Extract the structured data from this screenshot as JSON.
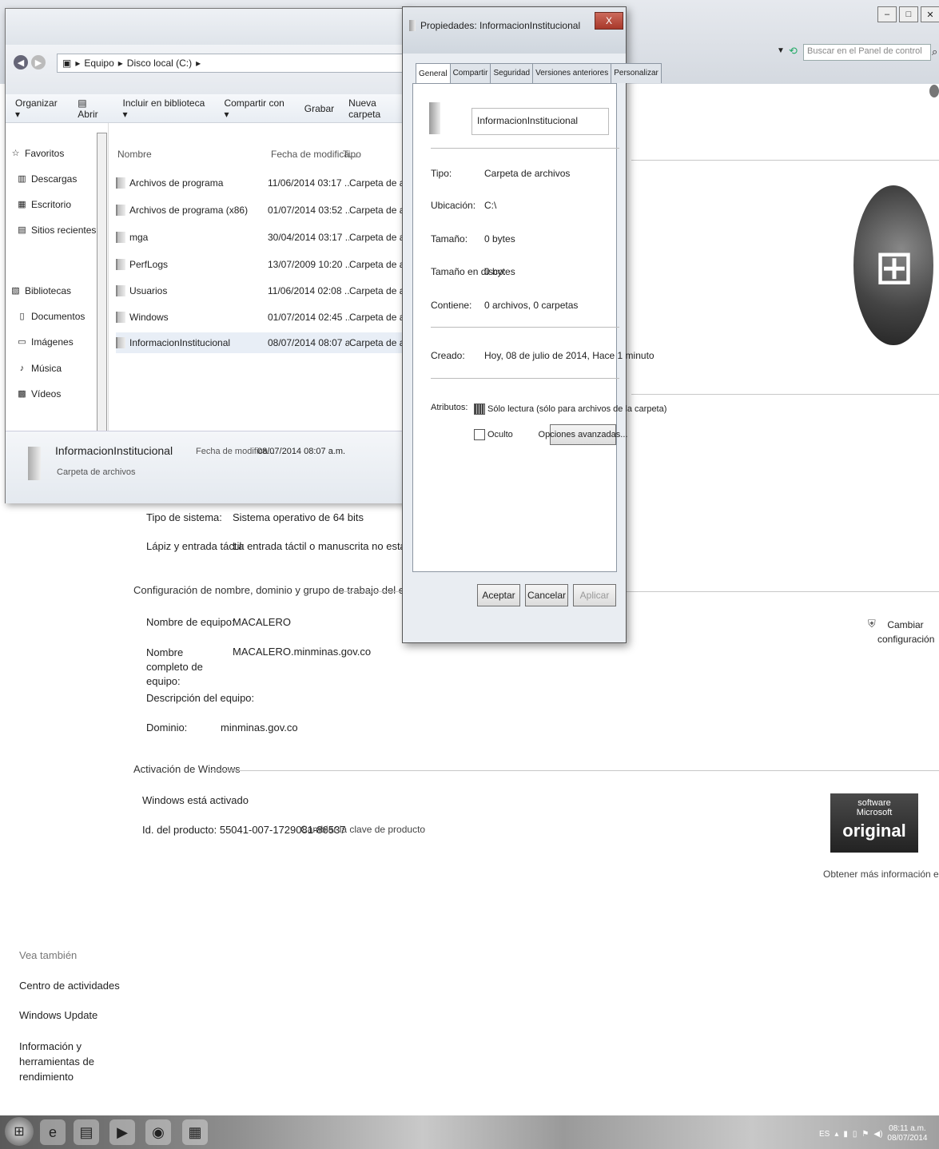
{
  "control_panel": {
    "search_placeholder": "Buscar en el Panel de control",
    "window_controls": [
      "–",
      "□",
      "✕"
    ],
    "system_rows": [
      {
        "label": "Tipo de sistema:",
        "value": "Sistema operativo de 64 bits"
      },
      {
        "label": "Lápiz y entrada táctil:",
        "value": "La entrada táctil o manuscrita no está disponible para e"
      }
    ],
    "computer_section_title": "Configuración de nombre, dominio y grupo de trabajo del equipo",
    "computer_rows": [
      {
        "label": "Nombre de equipo:",
        "value": "MACALERO"
      },
      {
        "label": "Nombre completo de equipo:",
        "value": "MACALERO.minminas.gov.co"
      },
      {
        "label": "Descripción del equipo:",
        "value": ""
      },
      {
        "label": "Dominio:",
        "value": "minminas.gov.co"
      }
    ],
    "change_settings": "Cambiar configuración",
    "activation_title": "Activación de Windows",
    "activation_status": "Windows está activado",
    "product_id": "Id. del producto: 55041-007-1729081-86537",
    "change_key": "Cambiar la clave de producto",
    "genuine_badge": {
      "line1": "software",
      "line2": "Microsoft",
      "line3": "original"
    },
    "more_info": "Obtener más información en línea...",
    "see_also_title": "Vea también",
    "see_also_links": [
      "Centro de actividades",
      "Windows Update",
      "Información y herramientas de rendimiento"
    ]
  },
  "explorer": {
    "breadcrumb": [
      "Equipo",
      "Disco local (C:)"
    ],
    "toolbar": [
      "Organizar ▾",
      "Abrir",
      "Incluir en biblioteca ▾",
      "Compartir con ▾",
      "Grabar",
      "Nueva carpeta"
    ],
    "nav": {
      "favorites": "Favoritos",
      "favorites_items": [
        "Descargas",
        "Escritorio",
        "Sitios recientes"
      ],
      "libraries": "Bibliotecas",
      "libraries_items": [
        "Documentos",
        "Imágenes",
        "Música",
        "Vídeos"
      ]
    },
    "columns": {
      "name": "Nombre",
      "date": "Fecha de modifica...",
      "type": "Tipo"
    },
    "files": [
      {
        "name": "Archivos de programa",
        "date": "11/06/2014 03:17 ...",
        "type": "Carpeta de archivos"
      },
      {
        "name": "Archivos de programa (x86)",
        "date": "01/07/2014 03:52 ...",
        "type": "Carpeta de archivos"
      },
      {
        "name": "mga",
        "date": "30/04/2014 03:17 ...",
        "type": "Carpeta de archivos"
      },
      {
        "name": "PerfLogs",
        "date": "13/07/2009 10:20 ...",
        "type": "Carpeta de archivos"
      },
      {
        "name": "Usuarios",
        "date": "11/06/2014 02:08 ...",
        "type": "Carpeta de archivos"
      },
      {
        "name": "Windows",
        "date": "01/07/2014 02:45 ...",
        "type": "Carpeta de archivos"
      },
      {
        "name": "InformacionInstitucional",
        "date": "08/07/2014 08:07 a...",
        "type": "Carpeta de archivos"
      }
    ],
    "status": {
      "name": "InformacionInstitucional",
      "date_label": "Fecha de modifica...",
      "date_value": "08/07/2014 08:07 a.m.",
      "type": "Carpeta de archivos"
    }
  },
  "properties": {
    "title": "Propiedades: InformacionInstitucional",
    "close_label": "X",
    "tabs": [
      "General",
      "Compartir",
      "Seguridad",
      "Versiones anteriores",
      "Personalizar"
    ],
    "folder_name": "InformacionInstitucional",
    "rows": [
      {
        "label": "Tipo:",
        "value": "Carpeta de archivos"
      },
      {
        "label": "Ubicación:",
        "value": "C:\\"
      },
      {
        "label": "Tamaño:",
        "value": "0 bytes"
      },
      {
        "label": "Tamaño en disco:",
        "value": "0 bytes"
      },
      {
        "label": "Contiene:",
        "value": "0 archivos, 0 carpetas"
      }
    ],
    "created_label": "Creado:",
    "created_value": "Hoy, 08 de julio de 2014, Hace 1 minuto",
    "attributes_label": "Atributos:",
    "readonly_label": "Sólo lectura (sólo para archivos de la carpeta)",
    "hidden_label": "Oculto",
    "advanced_button": "Opciones avanzadas...",
    "ok_button": "Aceptar",
    "cancel_button": "Cancelar",
    "apply_button": "Aplicar"
  },
  "taskbar": {
    "language": "ES",
    "time": "08:11 a.m.",
    "date": "08/07/2014"
  }
}
